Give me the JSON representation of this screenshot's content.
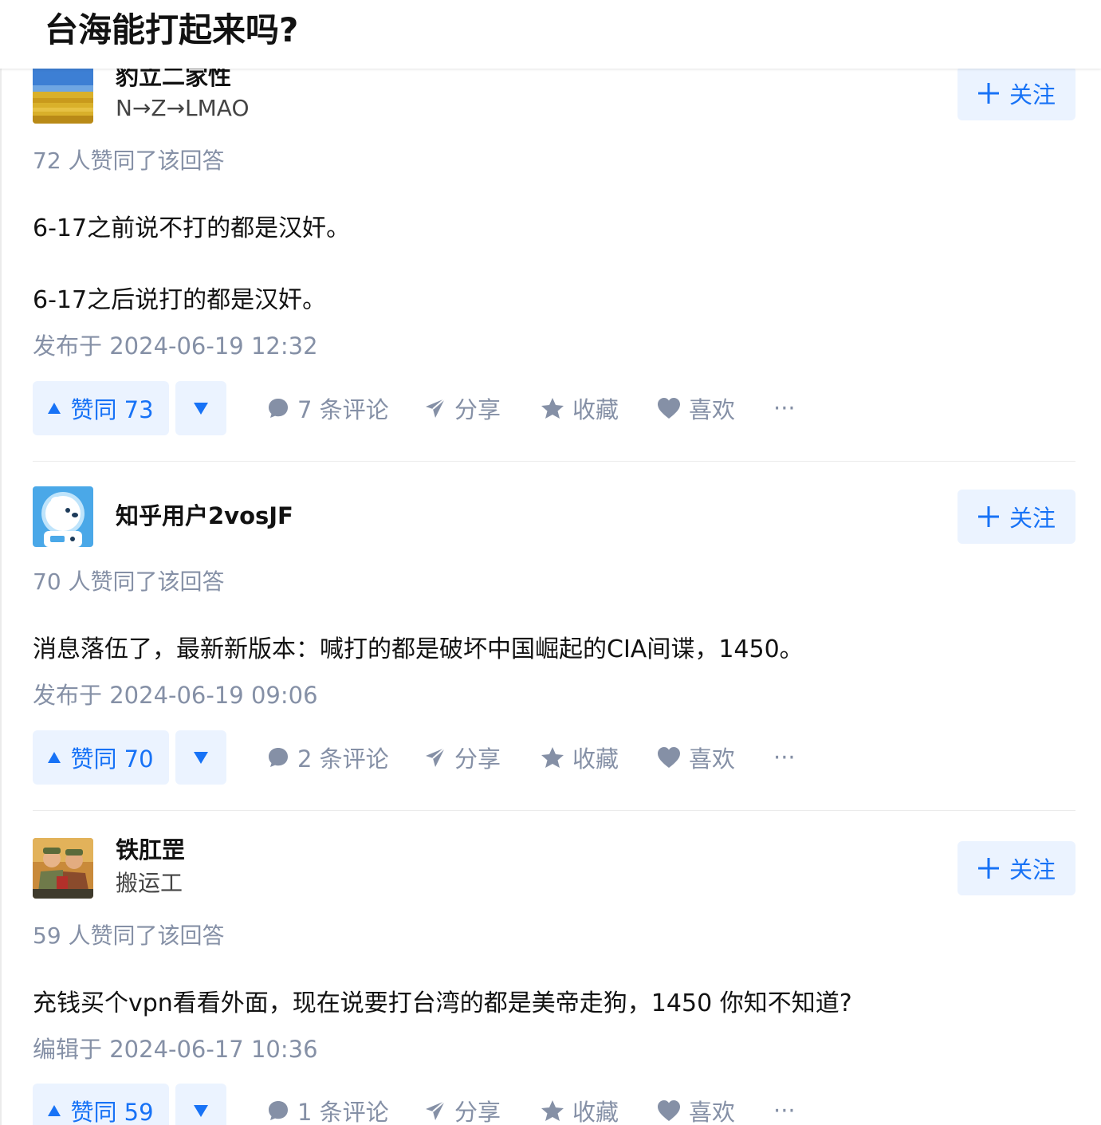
{
  "question": {
    "title": "台海能打起来吗?"
  },
  "answers": [
    {
      "author": {
        "name": "豹立二家性",
        "bio": "N→Z→LMAO"
      },
      "follow_label": "关注",
      "voters": "72 人赞同了该回答",
      "paragraphs": [
        "6-17之前说不打的都是汉奸。",
        "6-17之后说打的都是汉奸。"
      ],
      "time": "发布于 2024-06-19 12:32",
      "upvote_label": "赞同 73",
      "comments": "7 条评论",
      "share": "分享",
      "collect": "收藏",
      "like": "喜欢",
      "more": "···"
    },
    {
      "author": {
        "name": "知乎用户2vosJF"
      },
      "follow_label": "关注",
      "voters": "70 人赞同了该回答",
      "paragraphs": [
        "消息落伍了，最新新版本：喊打的都是破坏中国崛起的CIA间谍，1450。"
      ],
      "time": "发布于 2024-06-19 09:06",
      "upvote_label": "赞同 70",
      "comments": "2 条评论",
      "share": "分享",
      "collect": "收藏",
      "like": "喜欢",
      "more": "···"
    },
    {
      "author": {
        "name": "铁肛罡",
        "bio": "搬运工"
      },
      "follow_label": "关注",
      "voters": "59 人赞同了该回答",
      "paragraphs": [
        "充钱买个vpn看看外面，现在说要打台湾的都是美帝走狗，1450 你知不知道?"
      ],
      "time": "编辑于 2024-06-17 10:36",
      "upvote_label": "赞同 59",
      "comments": "1 条评论",
      "share": "分享",
      "collect": "收藏",
      "like": "喜欢",
      "more": "···"
    }
  ],
  "colors": {
    "accent": "#1772f6",
    "accent_bg": "#ebf3ff",
    "muted": "#8590a6"
  }
}
